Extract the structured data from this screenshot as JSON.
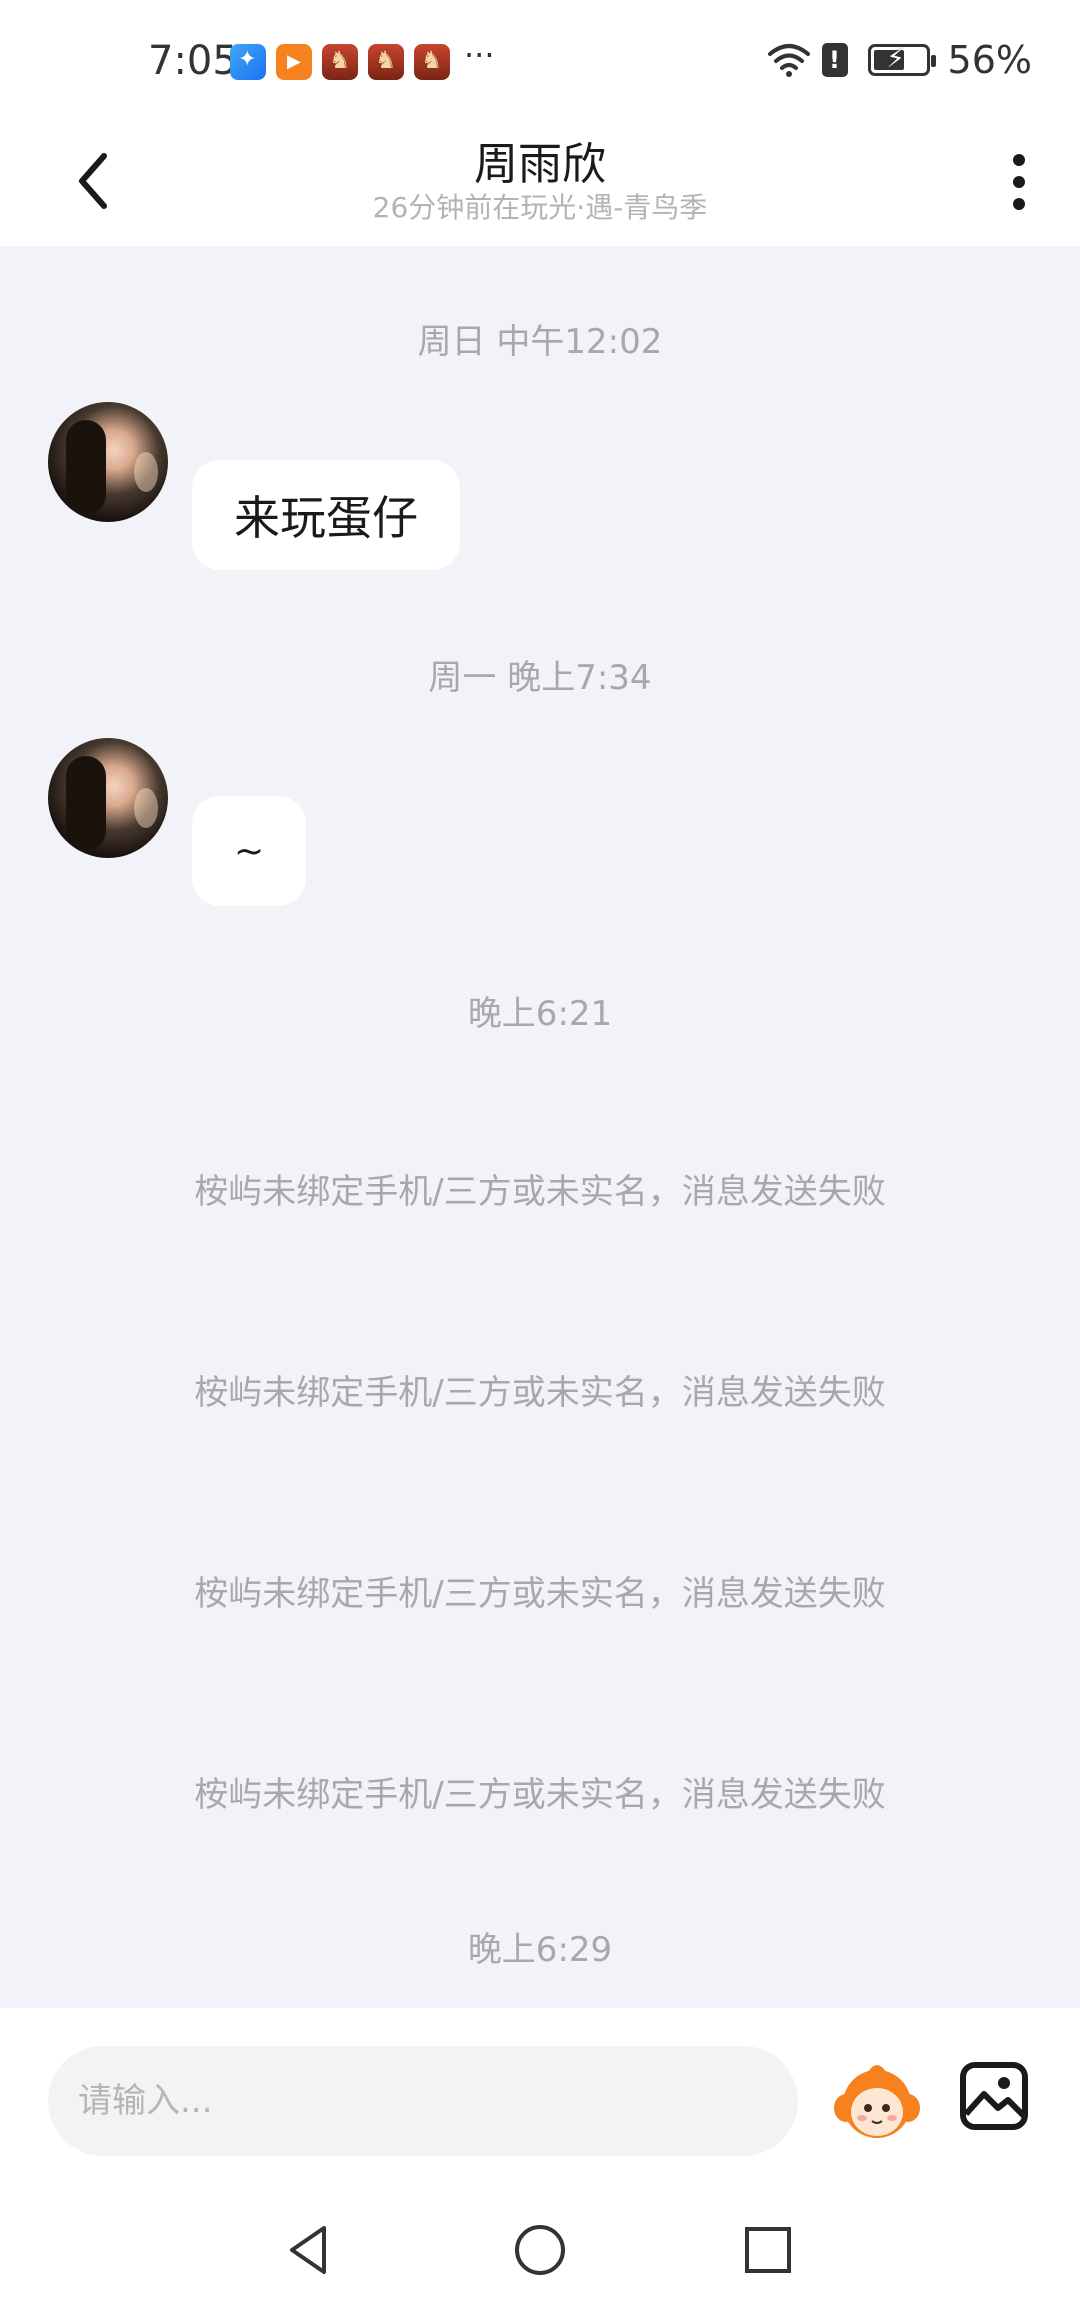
{
  "status_bar": {
    "time": "7:05",
    "more_indicator": "···",
    "alert_glyph": "!",
    "battery_percent": "56%"
  },
  "header": {
    "title": "周雨欣",
    "subtitle": "26分钟前在玩光·遇-青鸟季"
  },
  "messages": {
    "ts1": "周日 中午12:02",
    "msg1": "来玩蛋仔",
    "ts2": "周一 晚上7:34",
    "msg2": "~",
    "ts3": "晚上6:21",
    "system1": "桉屿未绑定手机/三方或未实名，消息发送失败",
    "system2": "桉屿未绑定手机/三方或未实名，消息发送失败",
    "system3": "桉屿未绑定手机/三方或未实名，消息发送失败",
    "system4": "桉屿未绑定手机/三方或未实名，消息发送失败",
    "ts4": "晚上6:29"
  },
  "input": {
    "placeholder": "请输入...",
    "value": ""
  },
  "icons": {
    "back": "chevron-left-icon",
    "menu": "more-vertical-icon",
    "emoji": "mascot-emoji-icon",
    "image": "image-icon",
    "nav_back": "triangle-back-icon",
    "nav_home": "circle-home-icon",
    "nav_recent": "square-recent-icon"
  },
  "colors": {
    "background": "#f2f3f8",
    "bubble": "#ffffff",
    "muted_text": "#a8a8a8",
    "mascot_orange": "#f5821f"
  }
}
